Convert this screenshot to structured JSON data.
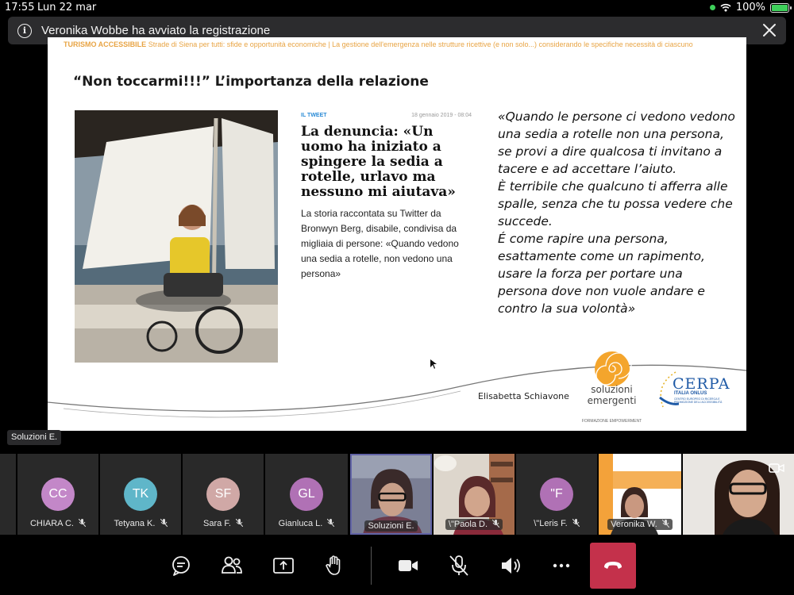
{
  "status_bar": {
    "time": "17:55",
    "date": "Lun 22 mar",
    "battery_percent": "100%",
    "battery_level": 1.0
  },
  "banner": {
    "message": "Veronika Wobbe ha avviato la registrazione"
  },
  "slide": {
    "header_bold": "TURISMO ACCESSIBILE",
    "header_rest": " Strade di Siena per tutti: sfide e opportunità economiche | La gestione dell'emergenza nelle strutture ricettive (e non solo...) considerando le specifiche necessità di ciascuno",
    "title": "“Non toccarmi!!!” L’importanza della relazione",
    "article": {
      "tag": "IL TWEET",
      "date": "18 gennaio 2019 - 08:04",
      "headline": "La denuncia: «Un uomo ha iniziato a spingere la sedia a rotelle, urlavo ma nessuno mi aiutava»",
      "body": "La storia raccontata su Twitter da Bronwyn Berg, disabile, condivisa da migliaia di persone: «Quando vedono una sedia a rotelle, non vedono una persona»"
    },
    "quote_lines": [
      "«Quando le persone ci vedono vedono una sedia a rotelle non una persona, se provi a dire qualcosa ti invitano a tacere e ad accettare l’aiuto.",
      "È terribile che qualcuno ti afferra alle spalle, senza che tu possa vedere che succede.",
      "É come rapire una persona, esattamente come un rapimento, usare la forza per portare una persona dove non vuole andare e contro la sua volontà»"
    ],
    "presenter": "Elisabetta Schiavone",
    "logo_soluzioni": {
      "line1": "soluzioni",
      "line2": "emergenti",
      "tagline": "FORMAZIONE  EMPOWERMENT"
    },
    "logo_cerpa": {
      "name": "CERPA",
      "sub": "ITALIA ONLUS",
      "small": "CENTRO EUROPEO DI RICERCA E PROMOZIONE DELL'ACCESSIBILITÀ"
    }
  },
  "tooltip": "Soluzioni E.",
  "participants": [
    {
      "initials": "CC",
      "name": "CHIARA C.",
      "color": "#c387c8",
      "muted": true
    },
    {
      "initials": "TK",
      "name": "Tetyana K.",
      "color": "#5fb6c9",
      "muted": true
    },
    {
      "initials": "SF",
      "name": "Sara F.",
      "color": "#d0a8a6",
      "muted": true
    },
    {
      "initials": "GL",
      "name": "Gianluca L.",
      "color": "#b071b5",
      "muted": true
    },
    {
      "initials": "",
      "name": "Soluzioni E.",
      "color": "#6264a7",
      "muted": false
    },
    {
      "initials": "",
      "name": "\\\"Paola D.",
      "color": "",
      "muted": true
    },
    {
      "initials": "\"F",
      "name": "\\\"Leris F.",
      "color": "#b071b5",
      "muted": true
    },
    {
      "initials": "",
      "name": "Veronika W.",
      "color": "",
      "muted": true
    },
    {
      "initials": "",
      "name": "",
      "color": "",
      "muted": false
    }
  ],
  "controls": {
    "chat": "chat-icon",
    "participants": "people-icon",
    "share": "share-screen-icon",
    "raise_hand": "raise-hand-icon",
    "camera": "camera-icon",
    "mic": "mic-off-icon",
    "speaker": "speaker-icon",
    "more": "more-icon",
    "hangup": "hang-up-icon",
    "hangup_color": "#c4314b"
  }
}
